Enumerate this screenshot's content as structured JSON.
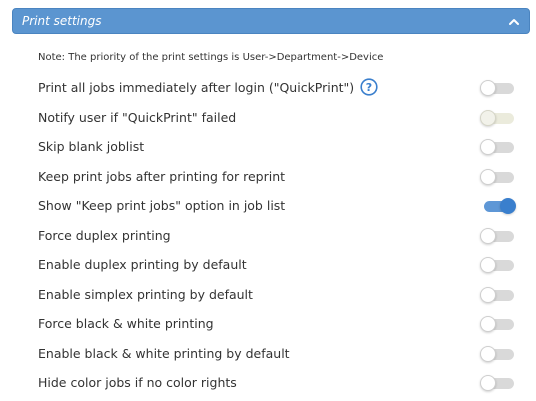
{
  "panel": {
    "title": "Print settings",
    "collapse_icon": "chevron-up-icon",
    "accent_color": "#5b95d0"
  },
  "note": "Note: The priority of the print settings is User->Department->Device",
  "settings": [
    {
      "label": "Print all jobs immediately after login (\"QuickPrint\")",
      "enabled": false,
      "has_help": true,
      "help_icon": "question-circle-icon"
    },
    {
      "label": "Notify user if \"QuickPrint\" failed",
      "enabled": false,
      "disabled": true
    },
    {
      "label": "Skip blank joblist",
      "enabled": false
    },
    {
      "label": "Keep print jobs after printing for reprint",
      "enabled": false
    },
    {
      "label": "Show \"Keep print jobs\" option in job list",
      "enabled": true
    },
    {
      "label": "Force duplex printing",
      "enabled": false
    },
    {
      "label": "Enable duplex printing by default",
      "enabled": false
    },
    {
      "label": "Enable simplex printing by default",
      "enabled": false
    },
    {
      "label": "Force black & white printing",
      "enabled": false
    },
    {
      "label": "Enable black & white printing by default",
      "enabled": false
    },
    {
      "label": "Hide color jobs if no color rights",
      "enabled": false
    }
  ]
}
